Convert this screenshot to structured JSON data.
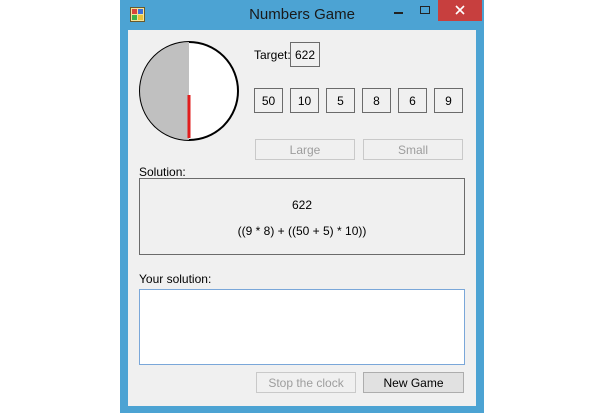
{
  "window": {
    "title": "Numbers Game",
    "accent_color": "#4ca3d3",
    "close_color": "#c73f3e",
    "icons": [
      "app-icon",
      "minimize-icon",
      "maximize-icon",
      "close-icon"
    ]
  },
  "clock": {
    "elapsed_fraction": 0.5,
    "hand_color": "#e11d1d",
    "elapsed_color": "#c0c0c0"
  },
  "target": {
    "label": "Target:",
    "value": "622"
  },
  "numbers": [
    "50",
    "10",
    "5",
    "8",
    "6",
    "9"
  ],
  "buttons": {
    "large": "Large",
    "small": "Small",
    "stop_clock": "Stop the clock",
    "new_game": "New Game"
  },
  "solution": {
    "label": "Solution:",
    "value": "622",
    "expression": "((9 * 8) + ((50 + 5) * 10))"
  },
  "your_solution": {
    "label": "Your solution:",
    "value": ""
  }
}
